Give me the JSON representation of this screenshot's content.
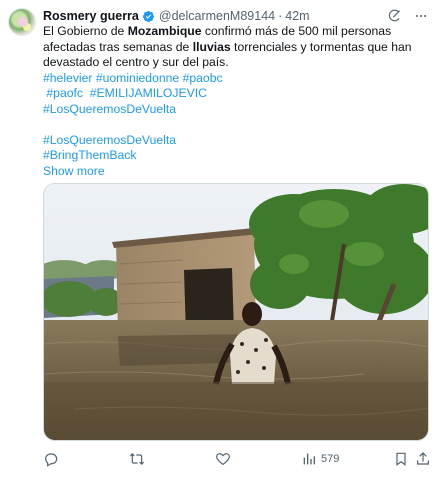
{
  "tweet": {
    "author_name": "Rosmery guerra",
    "handle": "@delcarmenM89144",
    "separator": "·",
    "time": "42m",
    "text": {
      "part1": "El Gobierno de ",
      "bold1": "Mozambique",
      "part2": " confirmó más de 500 mil personas afectadas tras semanas de ",
      "bold2": "lluvias",
      "part3": " torrenciales y tormentas que han devastado el centro y sur del país."
    },
    "hashtags_line1": "#helevier #uominiedonne #paobc",
    "hashtags_line2": " #paofc  #EMILIJAMILOJEVIC",
    "hashtags_line3": "#LosQueremosDeVuelta",
    "hashtags_line4": "#LosQueremosDeVuelta",
    "hashtags_line5": "#BringThemBack",
    "show_more": "Show more",
    "views_count": "579"
  },
  "icons": [
    "verified-badge-icon",
    "grok-icon",
    "more-icon",
    "reply-icon",
    "retweet-icon",
    "like-icon",
    "views-icon",
    "bookmark-icon",
    "share-icon"
  ],
  "colors": {
    "link": "#1d9bf0",
    "verified": "#1d9bf0",
    "muted": "#536471",
    "text": "#0f1419"
  }
}
